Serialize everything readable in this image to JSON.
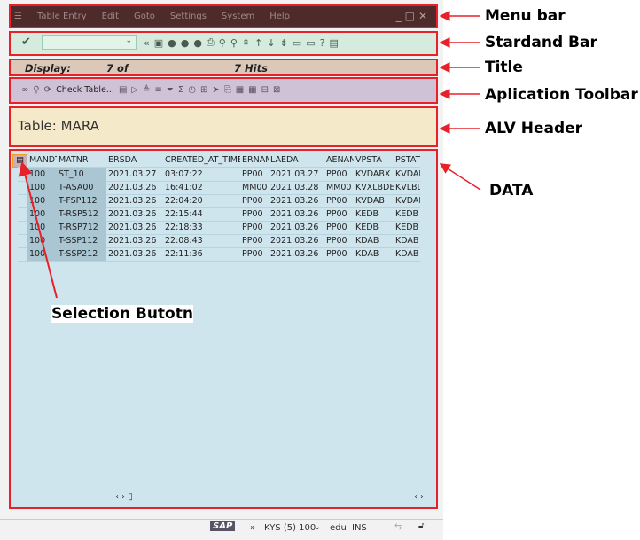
{
  "menu_bar": {
    "items": [
      "Table Entry",
      "Edit",
      "Goto",
      "Settings",
      "System",
      "Help"
    ]
  },
  "title_bar": {
    "display_label": "Display:",
    "count": "7 of",
    "hits": "7 Hits"
  },
  "app_toolbar": {
    "check_table": "Check Table..."
  },
  "alv_header": {
    "title": "Table: MARA"
  },
  "table": {
    "columns": [
      "MANDT",
      "MATNR",
      "ERSDA",
      "CREATED_AT_TIME",
      "ERNAM",
      "LAEDA",
      "AENAM",
      "VPSTA",
      "PSTAT"
    ],
    "rows": [
      [
        "100",
        "ST_10",
        "2021.03.27",
        "03:07:22",
        "PP00",
        "2021.03.27",
        "PP00",
        "KVDABX",
        "KVDAB"
      ],
      [
        "100",
        "T-ASA00",
        "2021.03.26",
        "16:41:02",
        "MM00",
        "2021.03.28",
        "MM00",
        "KVXLBDE",
        "KVLBDI"
      ],
      [
        "100",
        "T-FSP112",
        "2021.03.26",
        "22:04:20",
        "PP00",
        "2021.03.26",
        "PP00",
        "KVDAB",
        "KVDAB"
      ],
      [
        "100",
        "T-RSP512",
        "2021.03.26",
        "22:15:44",
        "PP00",
        "2021.03.26",
        "PP00",
        "KEDB",
        "KEDB"
      ],
      [
        "100",
        "T-RSP712",
        "2021.03.26",
        "22:18:33",
        "PP00",
        "2021.03.26",
        "PP00",
        "KEDB",
        "KEDB"
      ],
      [
        "100",
        "T-SSP112",
        "2021.03.26",
        "22:08:43",
        "PP00",
        "2021.03.26",
        "PP00",
        "KDAB",
        "KDAB"
      ],
      [
        "100",
        "T-SSP212",
        "2021.03.26",
        "22:11:36",
        "PP00",
        "2021.03.26",
        "PP00",
        "KDAB",
        "KDAB"
      ]
    ]
  },
  "status_bar": {
    "logo": "SAP",
    "system": "KYS (5) 100",
    "user": "edu",
    "mode": "INS"
  },
  "annotations": {
    "menu_bar": "Menu bar",
    "standard_bar": "Stardand Bar",
    "title": "Title",
    "app_toolbar": "Aplication Toolbar",
    "alv_header": "ALV Header",
    "data": "DATA",
    "selection_button": "Selection Butotn"
  },
  "colors": {
    "annotation": "#e8202a"
  }
}
